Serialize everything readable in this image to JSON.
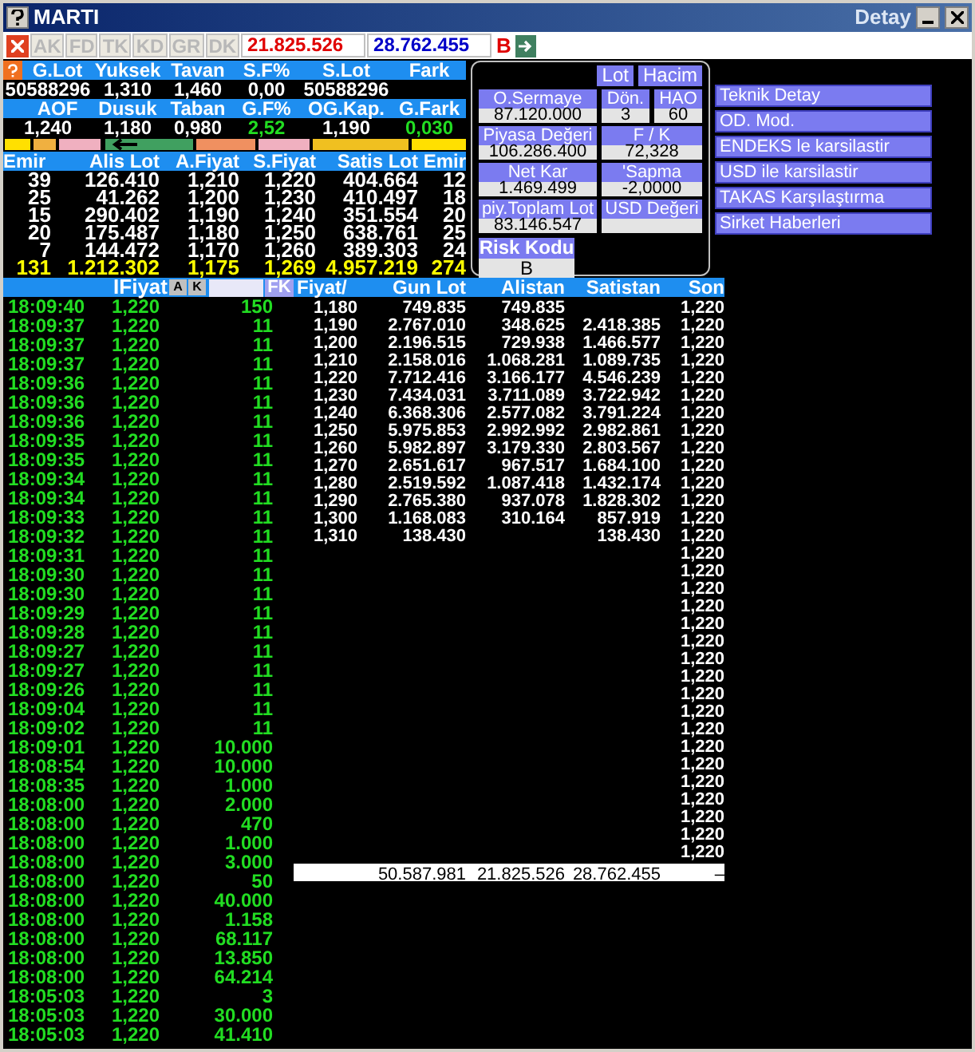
{
  "window": {
    "title": "MARTI",
    "subtitle": "Detay"
  },
  "toolbar": {
    "buttons": [
      {
        "label": "AK",
        "disabled": true
      },
      {
        "label": "FD",
        "disabled": true
      },
      {
        "label": "TK",
        "disabled": true
      },
      {
        "label": "KD",
        "disabled": true
      },
      {
        "label": "GR",
        "disabled": true
      },
      {
        "label": "DK",
        "disabled": true
      }
    ],
    "totals": [
      {
        "text": "21.825.526",
        "color": "#e00000"
      },
      {
        "text": "28.762.455",
        "color": "#0000c8"
      }
    ],
    "flag": "B"
  },
  "summary": {
    "rows": [
      {
        "headers": [
          "G.Lot",
          "Yuksek",
          "Tavan",
          "S.F%",
          "S.Lot",
          "Fark"
        ],
        "values": [
          {
            "text": "50588296",
            "positive": false
          },
          {
            "text": "1,310",
            "positive": false
          },
          {
            "text": "1,460",
            "positive": false
          },
          {
            "text": "0,00",
            "positive": false
          },
          {
            "text": "50588296",
            "positive": false
          }
        ]
      },
      {
        "headers": [
          "AOF",
          "Dusuk",
          "Taban",
          "G.F%",
          "OG.Kap.",
          "G.Fark"
        ],
        "values": [
          {
            "text": "1,240",
            "positive": false
          },
          {
            "text": "1,180",
            "positive": false
          },
          {
            "text": "0,980",
            "positive": false
          },
          {
            "text": "2,52",
            "positive": true
          },
          {
            "text": "1,190",
            "positive": false
          },
          {
            "text": "0,030",
            "positive": true
          }
        ]
      }
    ]
  },
  "order_book": {
    "columns": [
      "Emir",
      "Alis Lot",
      "A.Fiyat",
      "S.Fiyat",
      "Satis Lot",
      "Emir"
    ],
    "rows": [
      [
        "39",
        "126.410",
        "1,210",
        "1,220",
        "404.664",
        "12"
      ],
      [
        "25",
        "41.262",
        "1,200",
        "1,230",
        "410.497",
        "18"
      ],
      [
        "15",
        "290.402",
        "1,190",
        "1,240",
        "351.554",
        "20"
      ],
      [
        "20",
        "175.487",
        "1,180",
        "1,250",
        "638.761",
        "25"
      ],
      [
        "7",
        "144.472",
        "1,170",
        "1,260",
        "389.303",
        "24"
      ]
    ],
    "totals": [
      "131",
      "1.212.302",
      "1,175",
      "1,269",
      "4.957.219",
      "274"
    ]
  },
  "stats_panel": {
    "toggles": [
      "Lot",
      "Hacim"
    ],
    "rows": [
      [
        {
          "label": "O.Sermaye",
          "value": "87.120.000"
        },
        {
          "label": "Dön.",
          "value": "3"
        },
        {
          "label": "HAO",
          "value": "60"
        }
      ],
      [
        {
          "label": "Piyasa Değeri",
          "value": "106.286.400"
        },
        {
          "label": "F / K",
          "value": "72,328"
        }
      ],
      [
        {
          "label": "Net Kar",
          "value": "1.469.499"
        },
        {
          "label": "'Sapma",
          "value": "-2,0000"
        }
      ],
      [
        {
          "label": "piy.Toplam Lot",
          "value": "83.146.547"
        },
        {
          "label": "USD Değeri"
        }
      ]
    ],
    "risk": {
      "label": "Risk Kodu",
      "value": "B"
    }
  },
  "links": [
    "Teknik Detay",
    "OD. Mod.",
    "ENDEKS le karsilastir",
    "USD ile karsilastir",
    "TAKAS Karşılaştırma",
    "Sirket Haberleri"
  ],
  "trades": {
    "header": "IFiyat",
    "buttons": [
      "A",
      "K"
    ],
    "filter_button": "FK",
    "rows": [
      [
        "18:09:40",
        "1,220",
        "150"
      ],
      [
        "18:09:37",
        "1,220",
        "11"
      ],
      [
        "18:09:37",
        "1,220",
        "11"
      ],
      [
        "18:09:37",
        "1,220",
        "11"
      ],
      [
        "18:09:36",
        "1,220",
        "11"
      ],
      [
        "18:09:36",
        "1,220",
        "11"
      ],
      [
        "18:09:36",
        "1,220",
        "11"
      ],
      [
        "18:09:35",
        "1,220",
        "11"
      ],
      [
        "18:09:35",
        "1,220",
        "11"
      ],
      [
        "18:09:34",
        "1,220",
        "11"
      ],
      [
        "18:09:34",
        "1,220",
        "11"
      ],
      [
        "18:09:33",
        "1,220",
        "11"
      ],
      [
        "18:09:32",
        "1,220",
        "11"
      ],
      [
        "18:09:31",
        "1,220",
        "11"
      ],
      [
        "18:09:30",
        "1,220",
        "11"
      ],
      [
        "18:09:30",
        "1,220",
        "11"
      ],
      [
        "18:09:29",
        "1,220",
        "11"
      ],
      [
        "18:09:28",
        "1,220",
        "11"
      ],
      [
        "18:09:27",
        "1,220",
        "11"
      ],
      [
        "18:09:27",
        "1,220",
        "11"
      ],
      [
        "18:09:26",
        "1,220",
        "11"
      ],
      [
        "18:09:04",
        "1,220",
        "11"
      ],
      [
        "18:09:02",
        "1,220",
        "11"
      ],
      [
        "18:09:01",
        "1,220",
        "10.000"
      ],
      [
        "18:08:54",
        "1,220",
        "10.000"
      ],
      [
        "18:08:35",
        "1,220",
        "1.000"
      ],
      [
        "18:08:00",
        "1,220",
        "2.000"
      ],
      [
        "18:08:00",
        "1,220",
        "470"
      ],
      [
        "18:08:00",
        "1,220",
        "1.000"
      ],
      [
        "18:08:00",
        "1,220",
        "3.000"
      ],
      [
        "18:08:00",
        "1,220",
        "50"
      ],
      [
        "18:08:00",
        "1,220",
        "40.000"
      ],
      [
        "18:08:00",
        "1,220",
        "1.158"
      ],
      [
        "18:08:00",
        "1,220",
        "68.117"
      ],
      [
        "18:08:00",
        "1,220",
        "13.850"
      ],
      [
        "18:08:00",
        "1,220",
        "64.214"
      ],
      [
        "18:05:03",
        "1,220",
        "3"
      ],
      [
        "18:05:03",
        "1,220",
        "30.000"
      ],
      [
        "18:05:03",
        "1,220",
        "41.410"
      ]
    ]
  },
  "prices": {
    "columns": [
      "Fiyat/",
      "Gun Lot",
      "Alistan",
      "Satistan",
      "Son"
    ],
    "rows": [
      {
        "fiyat": "1,180",
        "gun_lot": "749.835",
        "alistan": "749.835",
        "son": "1,220"
      },
      {
        "fiyat": "1,190",
        "gun_lot": "2.767.010",
        "alistan": "348.625",
        "satistan": "2.418.385",
        "son": "1,220"
      },
      {
        "fiyat": "1,200",
        "gun_lot": "2.196.515",
        "alistan": "729.938",
        "satistan": "1.466.577",
        "son": "1,220"
      },
      {
        "fiyat": "1,210",
        "gun_lot": "2.158.016",
        "alistan": "1.068.281",
        "satistan": "1.089.735",
        "son": "1,220"
      },
      {
        "fiyat": "1,220",
        "gun_lot": "7.712.416",
        "alistan": "3.166.177",
        "satistan": "4.546.239",
        "son": "1,220"
      },
      {
        "fiyat": "1,230",
        "gun_lot": "7.434.031",
        "alistan": "3.711.089",
        "satistan": "3.722.942",
        "son": "1,220"
      },
      {
        "fiyat": "1,240",
        "gun_lot": "6.368.306",
        "alistan": "2.577.082",
        "satistan": "3.791.224",
        "son": "1,220"
      },
      {
        "fiyat": "1,250",
        "gun_lot": "5.975.853",
        "alistan": "2.992.992",
        "satistan": "2.982.861",
        "son": "1,220"
      },
      {
        "fiyat": "1,260",
        "gun_lot": "5.982.897",
        "alistan": "3.179.330",
        "satistan": "2.803.567",
        "son": "1,220"
      },
      {
        "fiyat": "1,270",
        "gun_lot": "2.651.617",
        "alistan": "967.517",
        "satistan": "1.684.100",
        "son": "1,220"
      },
      {
        "fiyat": "1,280",
        "gun_lot": "2.519.592",
        "alistan": "1.087.418",
        "satistan": "1.432.174",
        "son": "1,220"
      },
      {
        "fiyat": "1,290",
        "gun_lot": "2.765.380",
        "alistan": "937.078",
        "satistan": "1.828.302",
        "son": "1,220"
      },
      {
        "fiyat": "1,300",
        "gun_lot": "1.168.083",
        "alistan": "310.164",
        "satistan": "857.919",
        "son": "1,220"
      },
      {
        "fiyat": "1,310",
        "gun_lot": "138.430",
        "satistan": "138.430",
        "son": "1,220"
      },
      {
        "son": "1,220"
      },
      {
        "son": "1,220"
      },
      {
        "son": "1,220"
      },
      {
        "son": "1,220"
      },
      {
        "son": "1,220"
      },
      {
        "son": "1,220"
      },
      {
        "son": "1,220"
      },
      {
        "son": "1,220"
      },
      {
        "son": "1,220"
      },
      {
        "son": "1,220"
      },
      {
        "son": "1,220"
      },
      {
        "son": "1,220"
      },
      {
        "son": "1,220"
      },
      {
        "son": "1,220"
      },
      {
        "son": "1,220"
      },
      {
        "son": "1,220"
      },
      {
        "son": "1,220"
      },
      {
        "son": "1,220"
      }
    ],
    "totals": {
      "gun_lot": "50.587.981",
      "alistan": "21.825.526",
      "satistan": "28.762.455",
      "son": "–"
    }
  }
}
